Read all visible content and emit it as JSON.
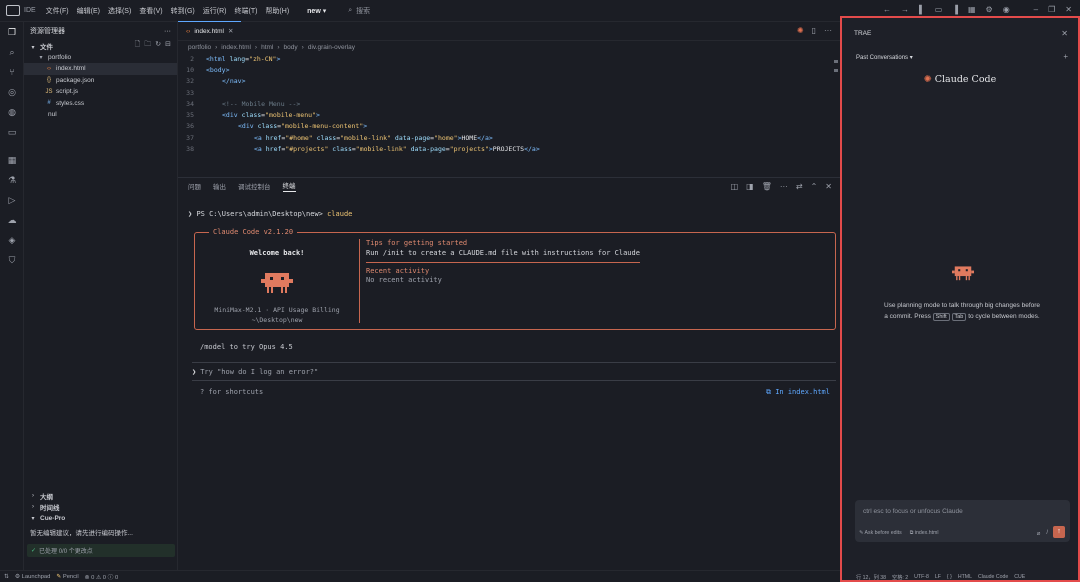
{
  "titlebar": {
    "app": "IDE",
    "menu": [
      "文件(F)",
      "编辑(E)",
      "选择(S)",
      "查看(V)",
      "转到(G)",
      "运行(R)",
      "终端(T)",
      "帮助(H)"
    ],
    "project": "new",
    "search_placeholder": "搜索"
  },
  "sidebar": {
    "title": "资源管理器",
    "files_label": "文件",
    "tree": [
      {
        "label": "portfolio",
        "icon": "folder-icon",
        "depth": 1
      },
      {
        "label": "index.html",
        "icon": "html-icon",
        "depth": 2,
        "selected": true
      },
      {
        "label": "package.json",
        "icon": "json-icon",
        "depth": 2
      },
      {
        "label": "script.js",
        "icon": "js-icon",
        "depth": 2
      },
      {
        "label": "styles.css",
        "icon": "css-icon",
        "depth": 2
      },
      {
        "label": "nul",
        "icon": "file-icon",
        "depth": 1
      }
    ],
    "sections": [
      "大纲",
      "时间线",
      "Cue-Pro"
    ],
    "cue_message": "暂无编辑建议，请先进行编码操作...",
    "cue_status": "已处理 0/0 个更改点"
  },
  "editor": {
    "tab_label": "index.html",
    "breadcrumb": [
      "portfolio",
      "index.html",
      "html",
      "body",
      "div.grain-overlay"
    ],
    "code_lines": [
      {
        "n": "2",
        "indent": 0,
        "parts": [
          [
            "tag",
            "<html "
          ],
          [
            "attr",
            "lang"
          ],
          [
            "txt",
            "="
          ],
          [
            "str",
            "\"zh-CN\""
          ],
          [
            "tag",
            ">"
          ]
        ]
      },
      {
        "n": "10",
        "indent": 0,
        "parts": [
          [
            "tag",
            "<body>"
          ]
        ]
      },
      {
        "n": "32",
        "indent": 1,
        "parts": [
          [
            "tag",
            "</nav>"
          ]
        ]
      },
      {
        "n": "33",
        "indent": 0,
        "parts": []
      },
      {
        "n": "34",
        "indent": 1,
        "parts": [
          [
            "cmt",
            "<!-- Mobile Menu -->"
          ]
        ]
      },
      {
        "n": "35",
        "indent": 1,
        "parts": [
          [
            "tag",
            "<div "
          ],
          [
            "attr",
            "class"
          ],
          [
            "txt",
            "="
          ],
          [
            "str",
            "\"mobile-menu\""
          ],
          [
            "tag",
            ">"
          ]
        ]
      },
      {
        "n": "36",
        "indent": 2,
        "parts": [
          [
            "tag",
            "<div "
          ],
          [
            "attr",
            "class"
          ],
          [
            "txt",
            "="
          ],
          [
            "str",
            "\"mobile-menu-content\""
          ],
          [
            "tag",
            ">"
          ]
        ]
      },
      {
        "n": "37",
        "indent": 3,
        "parts": [
          [
            "tag",
            "<a "
          ],
          [
            "attr",
            "href"
          ],
          [
            "txt",
            "="
          ],
          [
            "str",
            "\"#home\""
          ],
          [
            "attr",
            " class"
          ],
          [
            "txt",
            "="
          ],
          [
            "str",
            "\"mobile-link\""
          ],
          [
            "attr",
            " data-page"
          ],
          [
            "txt",
            "="
          ],
          [
            "str",
            "\"home\""
          ],
          [
            "tag",
            ">"
          ],
          [
            "txt",
            "HOME"
          ],
          [
            "tag",
            "</a>"
          ]
        ]
      },
      {
        "n": "38",
        "indent": 3,
        "parts": [
          [
            "tag",
            "<a "
          ],
          [
            "attr",
            "href"
          ],
          [
            "txt",
            "="
          ],
          [
            "str",
            "\"#projects\""
          ],
          [
            "attr",
            " class"
          ],
          [
            "txt",
            "="
          ],
          [
            "str",
            "\"mobile-link\""
          ],
          [
            "attr",
            " data-page"
          ],
          [
            "txt",
            "="
          ],
          [
            "str",
            "\"projects\""
          ],
          [
            "tag",
            ">"
          ],
          [
            "txt",
            "PROJECTS"
          ],
          [
            "tag",
            "</a>"
          ]
        ]
      }
    ]
  },
  "panel": {
    "tabs": [
      "问题",
      "输出",
      "调试控制台",
      "终端"
    ],
    "active_tab": "终端"
  },
  "terminal": {
    "prompt": "PS C:\\Users\\admin\\Desktop\\new>",
    "command": "claude",
    "box_title": "Claude Code v2.1.20",
    "welcome": "Welcome back!",
    "model_line": "MiniMax-M2.1 · API Usage Billing",
    "path_line": "~\\Desktop\\new",
    "tips_title": "Tips for getting started",
    "tips_text": "Run /init to create a CLAUDE.md file with instructions for Claude",
    "recent_title": "Recent activity",
    "recent_text": "No recent activity",
    "model_hint": "/model to try Opus 4.5",
    "input_placeholder": "Try \"how do I log an error?\"",
    "shortcuts": "? for shortcuts",
    "context": "In index.html"
  },
  "trae": {
    "title": "TRAE",
    "conversations": "Past Conversations",
    "brand": "Claude Code",
    "tip_before_shift": "Use planning mode to talk through big changes before a commit. Press",
    "kbd_shift": "Shift",
    "kbd_tab": "Tab",
    "tip_after": "to cycle between modes.",
    "input_placeholder": "ctrl esc to focus or unfocus Claude",
    "ask_before_edits": "Ask before edits",
    "context_file": "index.html",
    "slash": "/"
  },
  "status": {
    "launchpad": "Launchpad",
    "pencil": "Pencil",
    "errors": "0",
    "warnings": "0",
    "info": "0",
    "right_items": [
      "行 12，列 38",
      "空格: 2",
      "UTF-8",
      "LF",
      "{ }",
      "HTML",
      "Claude Code",
      "CUE"
    ]
  },
  "colors": {
    "accent_blue": "#5fa8ff",
    "claude_orange": "#c7664f",
    "highlight_red": "#e34b4b"
  }
}
